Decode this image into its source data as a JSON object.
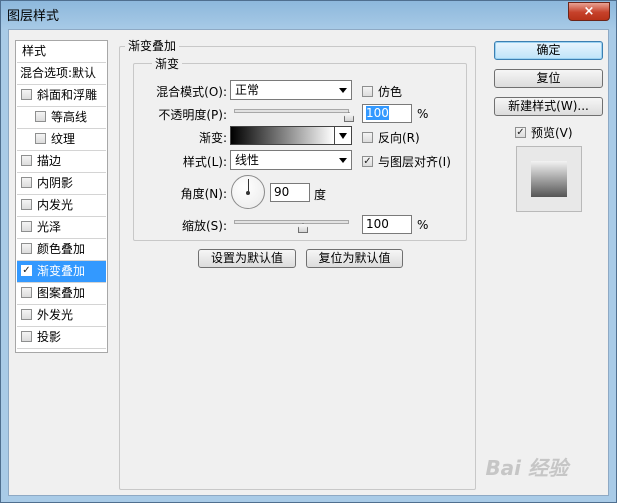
{
  "window": {
    "title": "图层样式",
    "close_label": "×"
  },
  "left_list": {
    "header": "样式",
    "blend_options": "混合选项:默认",
    "items": [
      {
        "label": "斜面和浮雕",
        "checked": false,
        "indent": false
      },
      {
        "label": "等高线",
        "checked": false,
        "indent": true
      },
      {
        "label": "纹理",
        "checked": false,
        "indent": true
      },
      {
        "label": "描边",
        "checked": false,
        "indent": false
      },
      {
        "label": "内阴影",
        "checked": false,
        "indent": false
      },
      {
        "label": "内发光",
        "checked": false,
        "indent": false
      },
      {
        "label": "光泽",
        "checked": false,
        "indent": false
      },
      {
        "label": "颜色叠加",
        "checked": false,
        "indent": false
      },
      {
        "label": "渐变叠加",
        "checked": true,
        "indent": false,
        "selected": true
      },
      {
        "label": "图案叠加",
        "checked": false,
        "indent": false
      },
      {
        "label": "外发光",
        "checked": false,
        "indent": false
      },
      {
        "label": "投影",
        "checked": false,
        "indent": false
      }
    ]
  },
  "gradient_overlay": {
    "section_title": "渐变叠加",
    "group_title": "渐变",
    "blend_mode_label": "混合模式(O):",
    "blend_mode_value": "正常",
    "dither_label": "仿色",
    "dither_checked": false,
    "opacity_label": "不透明度(P):",
    "opacity_value": "100",
    "opacity_unit": "%",
    "opacity_fraction": 1.0,
    "gradient_label": "渐变:",
    "reverse_label": "反向(R)",
    "reverse_checked": false,
    "style_label": "样式(L):",
    "style_value": "线性",
    "align_label": "与图层对齐(I)",
    "align_checked": true,
    "angle_label": "角度(N):",
    "angle_value": "90",
    "angle_unit": "度",
    "scale_label": "缩放(S):",
    "scale_value": "100",
    "scale_unit": "%",
    "scale_fraction": 0.6,
    "make_default_label": "设置为默认值",
    "reset_default_label": "复位为默认值"
  },
  "right_panel": {
    "ok_label": "确定",
    "reset_label": "复位",
    "new_style_label": "新建样式(W)...",
    "preview_label": "预览(V)",
    "preview_checked": true
  },
  "watermark": "Bai 经验"
}
